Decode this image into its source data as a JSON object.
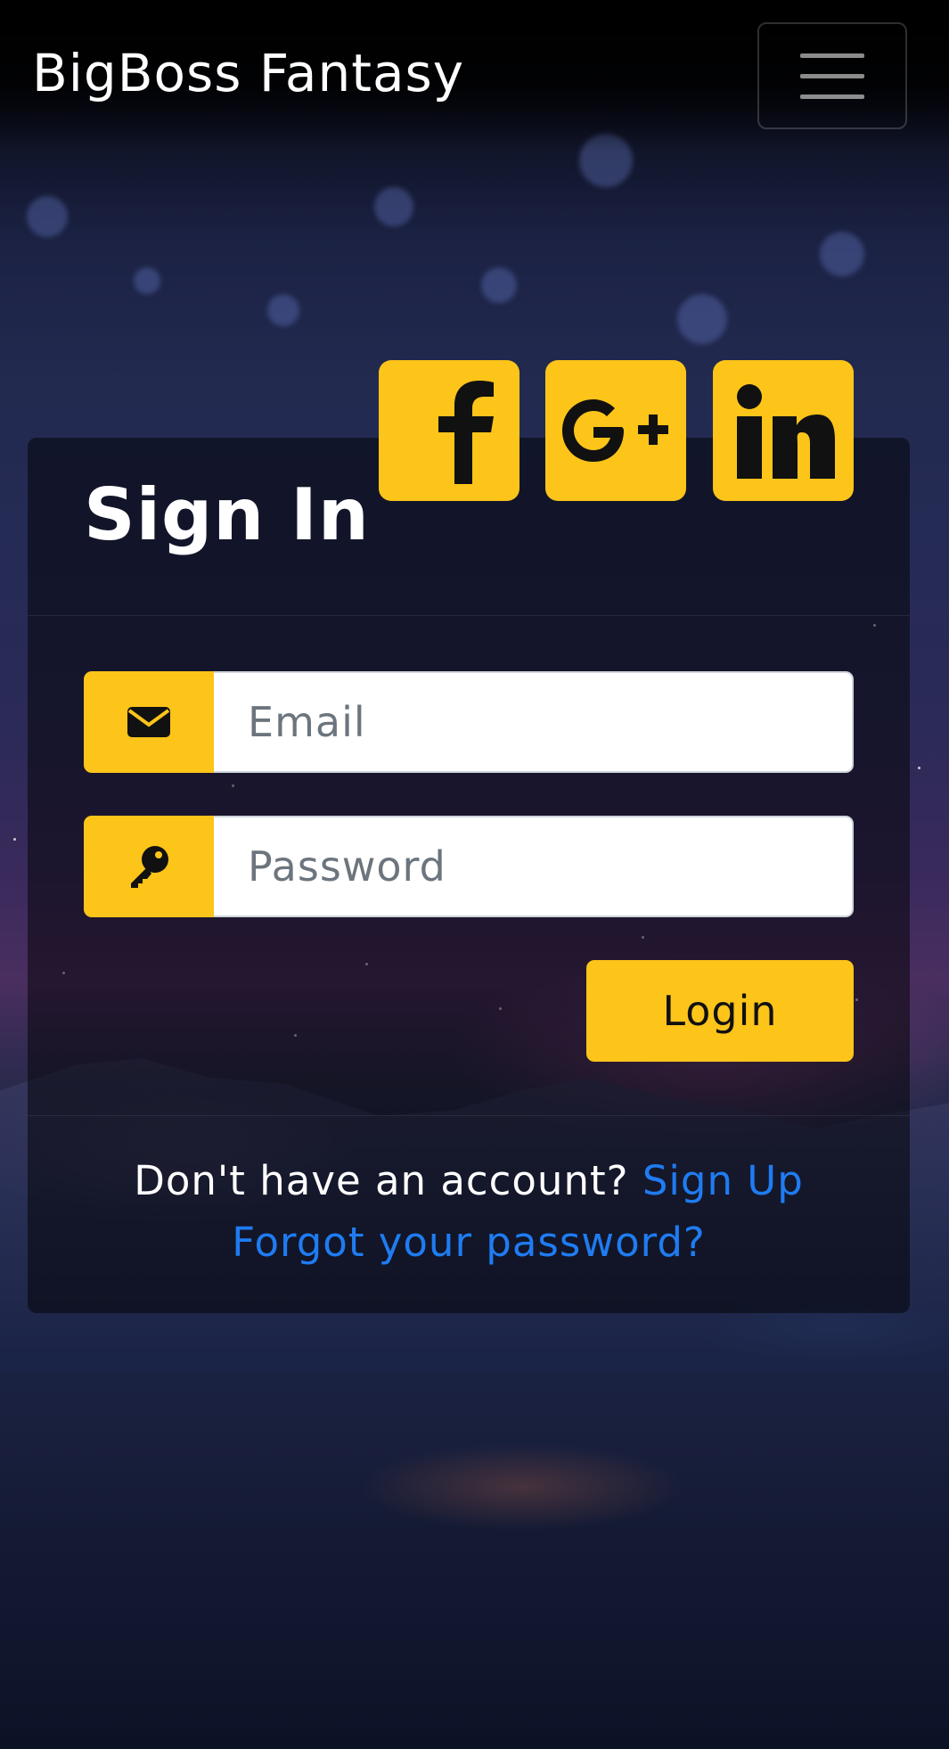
{
  "navbar": {
    "brand": "BigBoss Fantasy",
    "toggler_icon": "hamburger-menu-icon"
  },
  "signin": {
    "title": "Sign In",
    "social": [
      {
        "name": "facebook",
        "icon": "facebook-icon"
      },
      {
        "name": "google-plus",
        "icon": "google-plus-icon"
      },
      {
        "name": "linkedin",
        "icon": "linkedin-icon"
      }
    ],
    "email": {
      "placeholder": "Email",
      "value": "",
      "icon": "envelope-icon"
    },
    "password": {
      "placeholder": "Password",
      "value": "",
      "icon": "key-icon"
    },
    "login_label": "Login",
    "signup_prompt": "Don't have an account?",
    "signup_link": "Sign Up",
    "forgot_link": "Forgot your password?"
  },
  "colors": {
    "accent": "#fdc41a",
    "link": "#1f7cf2",
    "text": "#ffffff"
  }
}
